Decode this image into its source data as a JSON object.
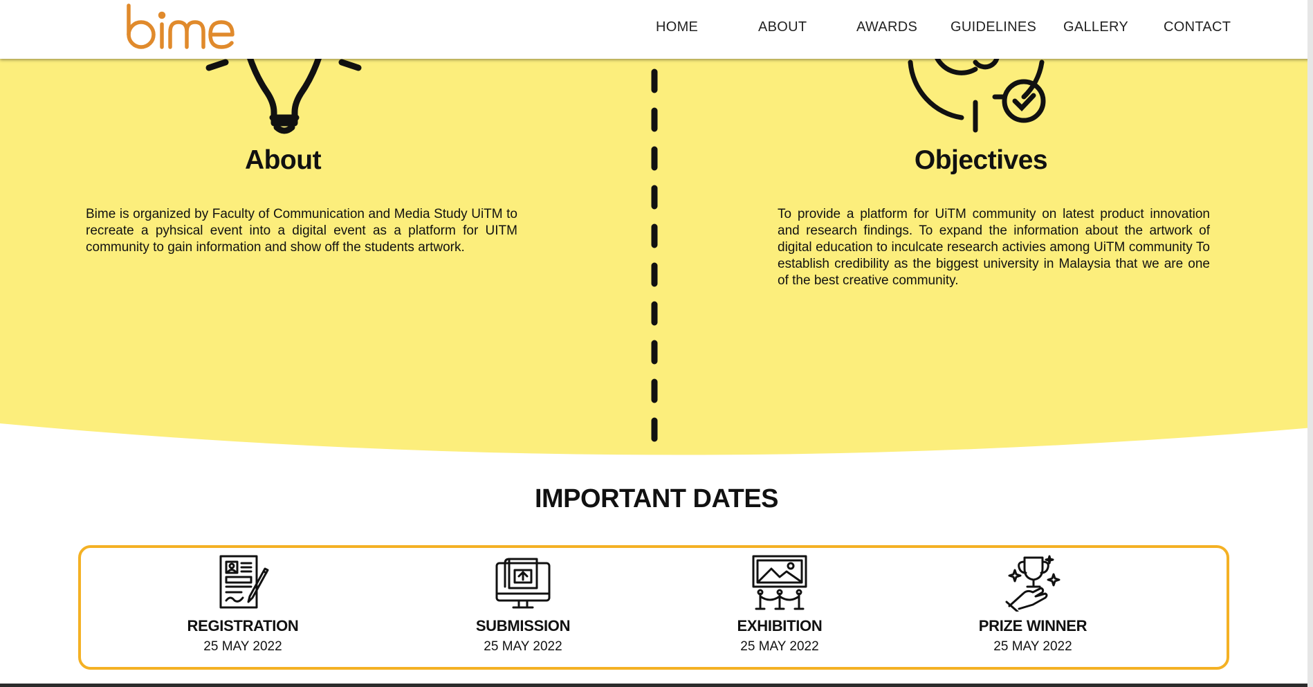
{
  "brand": {
    "logo_text": "bime",
    "logo_color": "#e08a2c"
  },
  "nav": {
    "items": [
      {
        "label": "HOME"
      },
      {
        "label": "ABOUT"
      },
      {
        "label": "AWARDS"
      },
      {
        "label": "GUIDELINES"
      },
      {
        "label": "GALLERY"
      },
      {
        "label": "CONTACT"
      }
    ]
  },
  "colors": {
    "band": "#fcee7c",
    "accent_border": "#f4b124",
    "text": "#111111"
  },
  "about": {
    "title": "About",
    "icon": "lightbulb-icon",
    "text": "Bime is organized by Faculty of Communication and Media Study UiTM to recreate a pyhsical event into a digital event as a platform for UITM community to gain information and show off the students artwork."
  },
  "objectives": {
    "title": "Objectives",
    "icon": "target-check-icon",
    "text": "To provide a platform for UiTM community on latest product innovation and research findings. To expand the information about the artwork of digital education to inculcate research activies among UiTM community To establish credibility as the biggest university in Malaysia that we are one of the best creative community."
  },
  "dates": {
    "title": "IMPORTANT DATES",
    "items": [
      {
        "label": "REGISTRATION",
        "date": "25 MAY 2022",
        "icon": "registration-form-icon"
      },
      {
        "label": "SUBMISSION",
        "date": "25 MAY 2022",
        "icon": "upload-monitor-icon"
      },
      {
        "label": "EXHIBITION",
        "date": "25 MAY 2022",
        "icon": "exhibition-picture-icon"
      },
      {
        "label": "PRIZE WINNER",
        "date": "25 MAY 2022",
        "icon": "trophy-hand-icon"
      }
    ]
  }
}
